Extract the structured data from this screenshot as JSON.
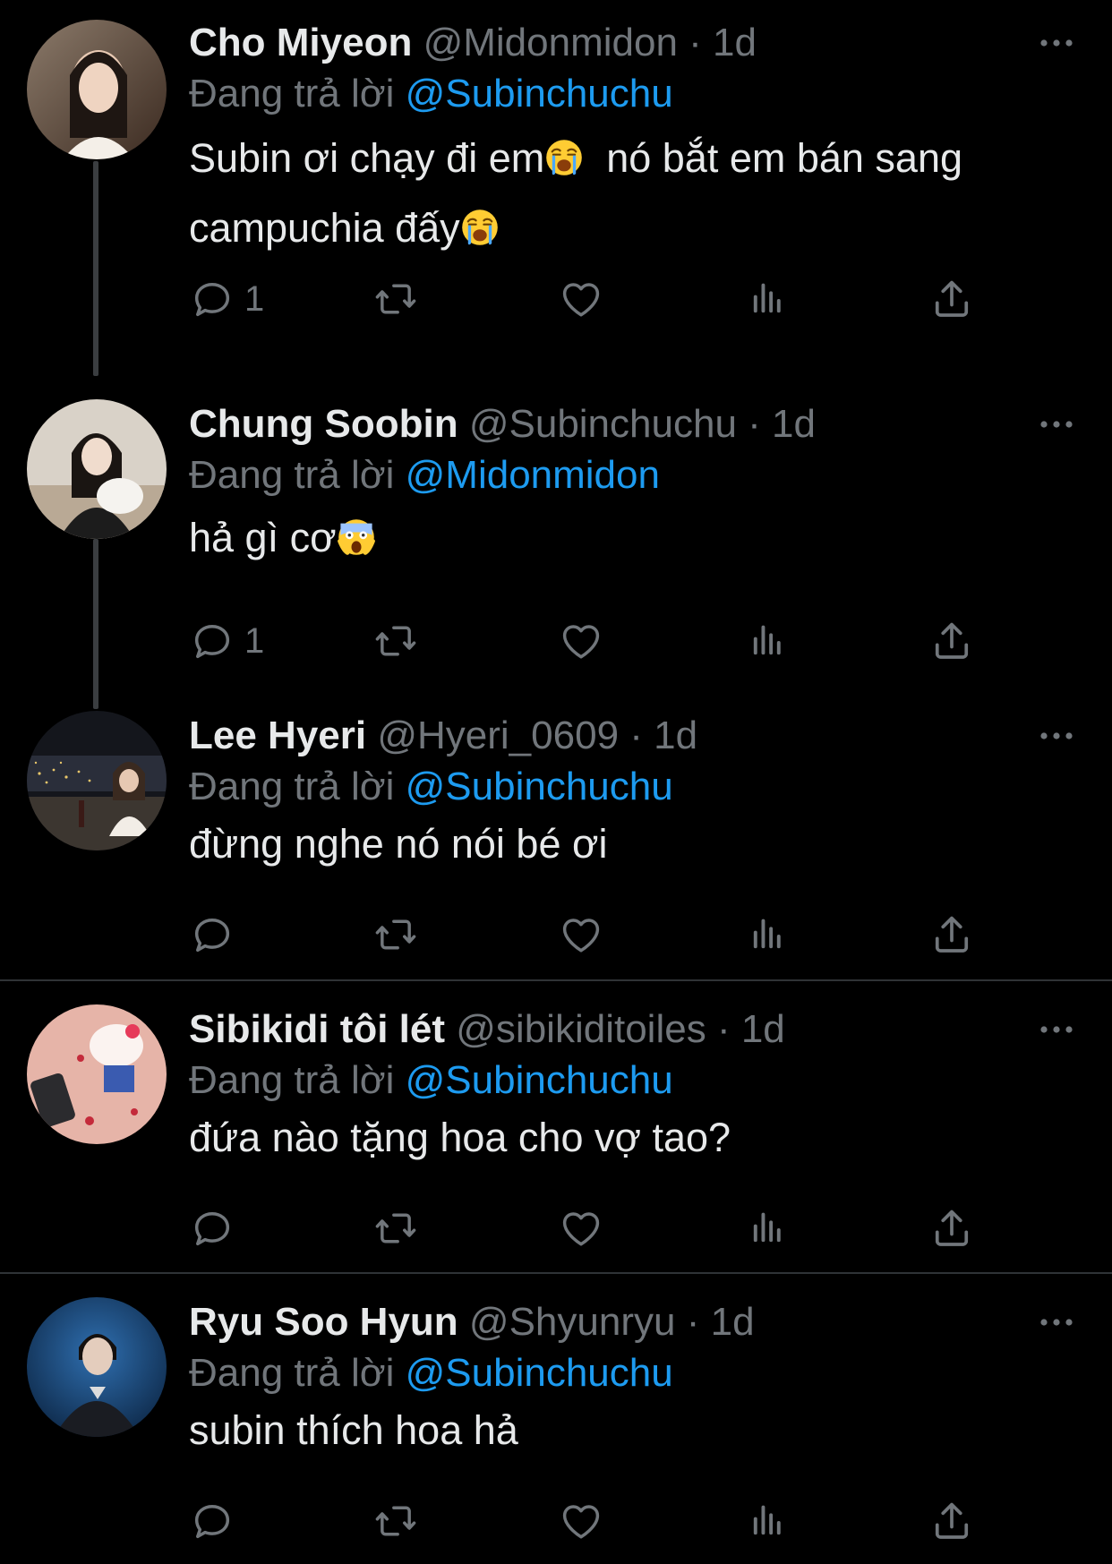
{
  "colors": {
    "background": "#000000",
    "text": "#e7e9ea",
    "muted": "#71767b",
    "mention": "#1d9bf0",
    "divider": "#2f3336",
    "thread_line": "#3a3d40"
  },
  "reply_label": "Đang trả lời",
  "tweets": [
    {
      "name": "Cho Miyeon",
      "handle": "@Midonmidon",
      "separator": "·",
      "time": "1d",
      "mention": "@Subinchuchu",
      "text_lines": [
        "Subin ơi chạy đi em",
        "nó bắt em bán sang",
        "campuchia đấy"
      ],
      "emoji": "loudly-crying-face",
      "reply_count": "1"
    },
    {
      "name": "Chung Soobin",
      "handle": "@Subinchuchu",
      "separator": "·",
      "time": "1d",
      "mention": "@Midonmidon",
      "text": "hả gì cơ",
      "emoji": "face-screaming-in-fear",
      "reply_count": "1"
    },
    {
      "name": "Lee Hyeri",
      "handle": "@Hyeri_0609",
      "separator": "·",
      "time": "1d",
      "mention": "@Subinchuchu",
      "text": "đừng nghe nó nói bé ơi",
      "reply_count": ""
    },
    {
      "name": "Sibikidi tôi lét",
      "handle": "@sibikiditoiles",
      "separator": "·",
      "time": "1d",
      "mention": "@Subinchuchu",
      "text": "đứa nào tặng hoa cho vợ tao?",
      "reply_count": ""
    },
    {
      "name": "Ryu Soo Hyun",
      "handle": "@Shyunryu",
      "separator": "·",
      "time": "1d",
      "mention": "@Subinchuchu",
      "text": "subin thích hoa hả",
      "reply_count": ""
    }
  ],
  "icons": [
    "reply-icon",
    "retweet-icon",
    "like-icon",
    "views-icon",
    "share-icon",
    "more-icon"
  ]
}
